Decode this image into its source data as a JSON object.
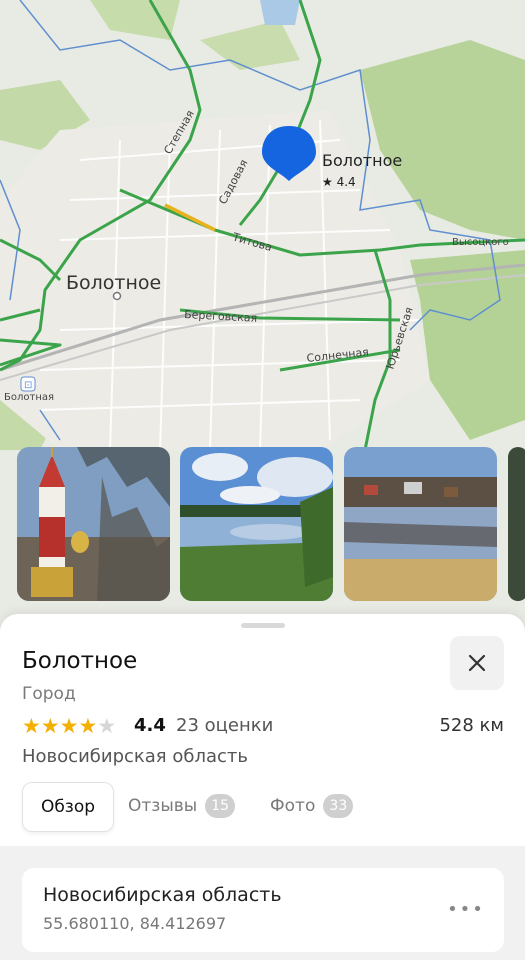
{
  "map": {
    "pin": {
      "name": "Болотное",
      "rating": "★ 4.4"
    },
    "city_label": "Болотное",
    "streets": [
      "Титова",
      "Береговская",
      "Солнечная",
      "Высоцкого",
      "Садовая",
      "Юрьевская",
      "Степная"
    ],
    "station_label": "Болотная"
  },
  "place": {
    "title": "Болотное",
    "category": "Город",
    "rating_value": "4.4",
    "rating_stars": 4,
    "rating_count": "23 оценки",
    "distance": "528 км",
    "region": "Новосибирская область"
  },
  "tabs": [
    {
      "label": "Обзор"
    },
    {
      "label": "Отзывы",
      "badge": "15"
    },
    {
      "label": "Фото",
      "badge": "33"
    }
  ],
  "address_card": {
    "title": "Новосибирская область",
    "coords": "55.680110, 84.412697"
  },
  "colors": {
    "pin": "#1565e0",
    "star": "#f4b000",
    "roads": "#3ba44a",
    "accent_road": "#e8b21f"
  }
}
